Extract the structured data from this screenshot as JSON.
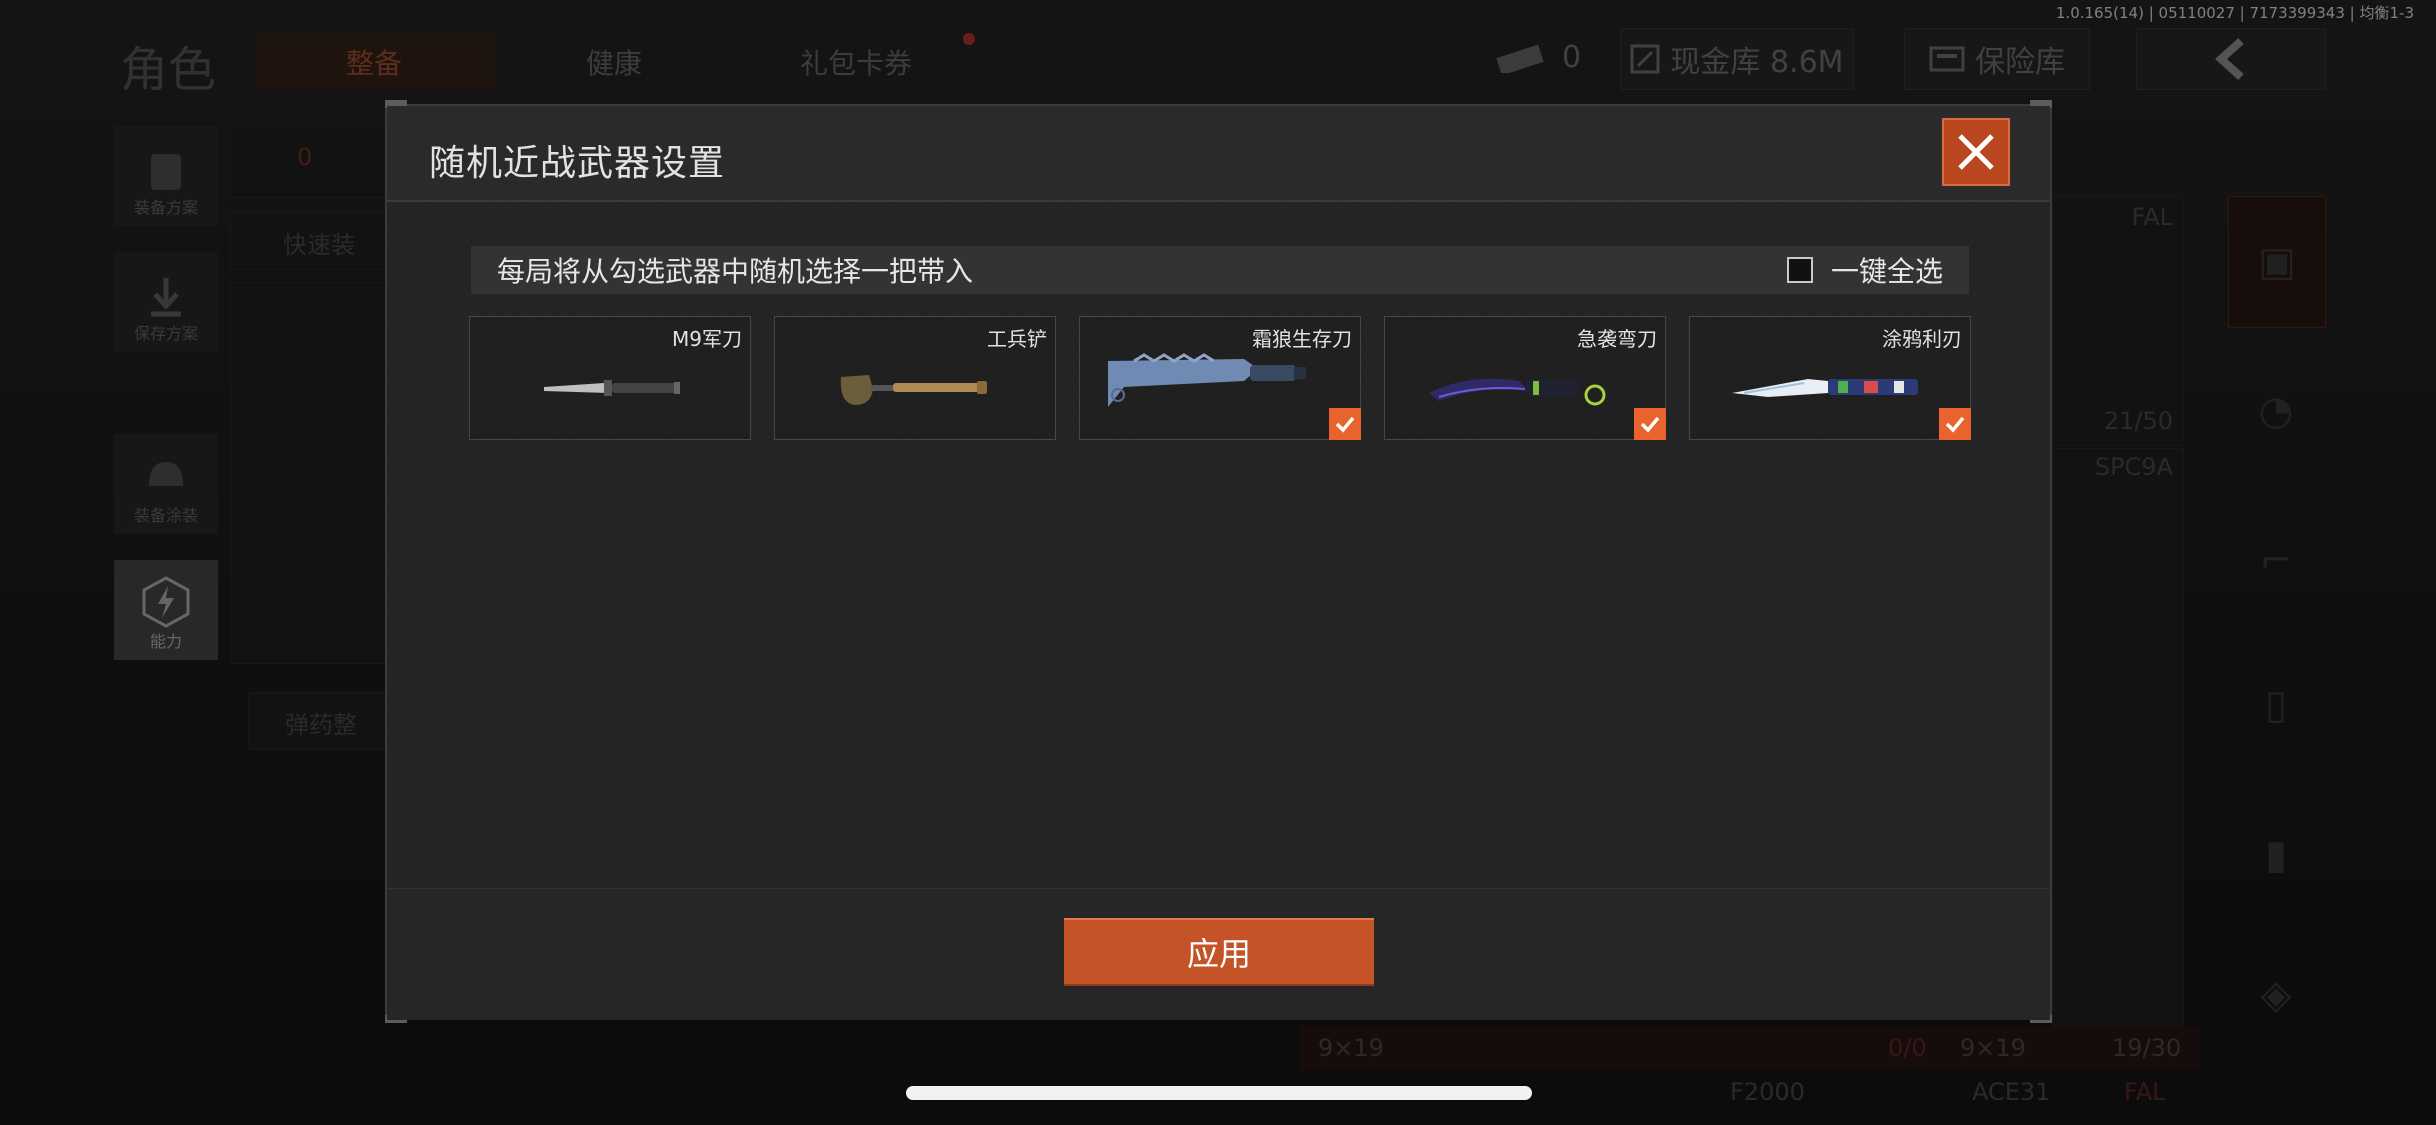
{
  "status": {
    "version": "1.0.165(14) | 05110027 | 7173399343 | 均衡1-3"
  },
  "background": {
    "title": "角色",
    "tabs": [
      {
        "label": "整备",
        "active": true
      },
      {
        "label": "健康",
        "active": false
      },
      {
        "label": "礼包卡券",
        "active": false
      }
    ],
    "currency_count": "0",
    "cash_label": "现金库 8.6M",
    "insurance_label": "保险库",
    "left_menu": [
      {
        "label": "装备方案"
      },
      {
        "label": "保存方案"
      },
      {
        "label": "装备涂装"
      },
      {
        "label": "能力"
      }
    ],
    "bag_count": "0",
    "quick_label": "快速装",
    "ammo_label": "弹药整",
    "weapon_labels": {
      "fal_top": "FAL",
      "ammo_21_50": "21/50",
      "spc9a": "SPC9A",
      "caliber_a": "9×19",
      "caliber_b": "9×19",
      "ammo_0_0": "0/0",
      "ammo_19_30": "19/30",
      "f2000": "F2000",
      "ace31": "ACE31",
      "fal_bottom": "FAL"
    }
  },
  "modal": {
    "title": "随机近战武器设置",
    "subtitle": "每局将从勾选武器中随机选择一把带入",
    "select_all_label": "一键全选",
    "select_all_checked": false,
    "weapons": [
      {
        "name": "M9军刀",
        "checked": false,
        "icon": "bayonet-icon"
      },
      {
        "name": "工兵铲",
        "checked": false,
        "icon": "shovel-icon"
      },
      {
        "name": "霜狼生存刀",
        "checked": true,
        "icon": "survival-knife-icon"
      },
      {
        "name": "急袭弯刀",
        "checked": true,
        "icon": "karambit-icon"
      },
      {
        "name": "涂鸦利刃",
        "checked": true,
        "icon": "graffiti-blade-icon"
      }
    ],
    "apply_label": "应用"
  },
  "colors": {
    "accent": "#e8632d",
    "accent_dark": "#c45428",
    "close_bg": "#b8461f"
  }
}
